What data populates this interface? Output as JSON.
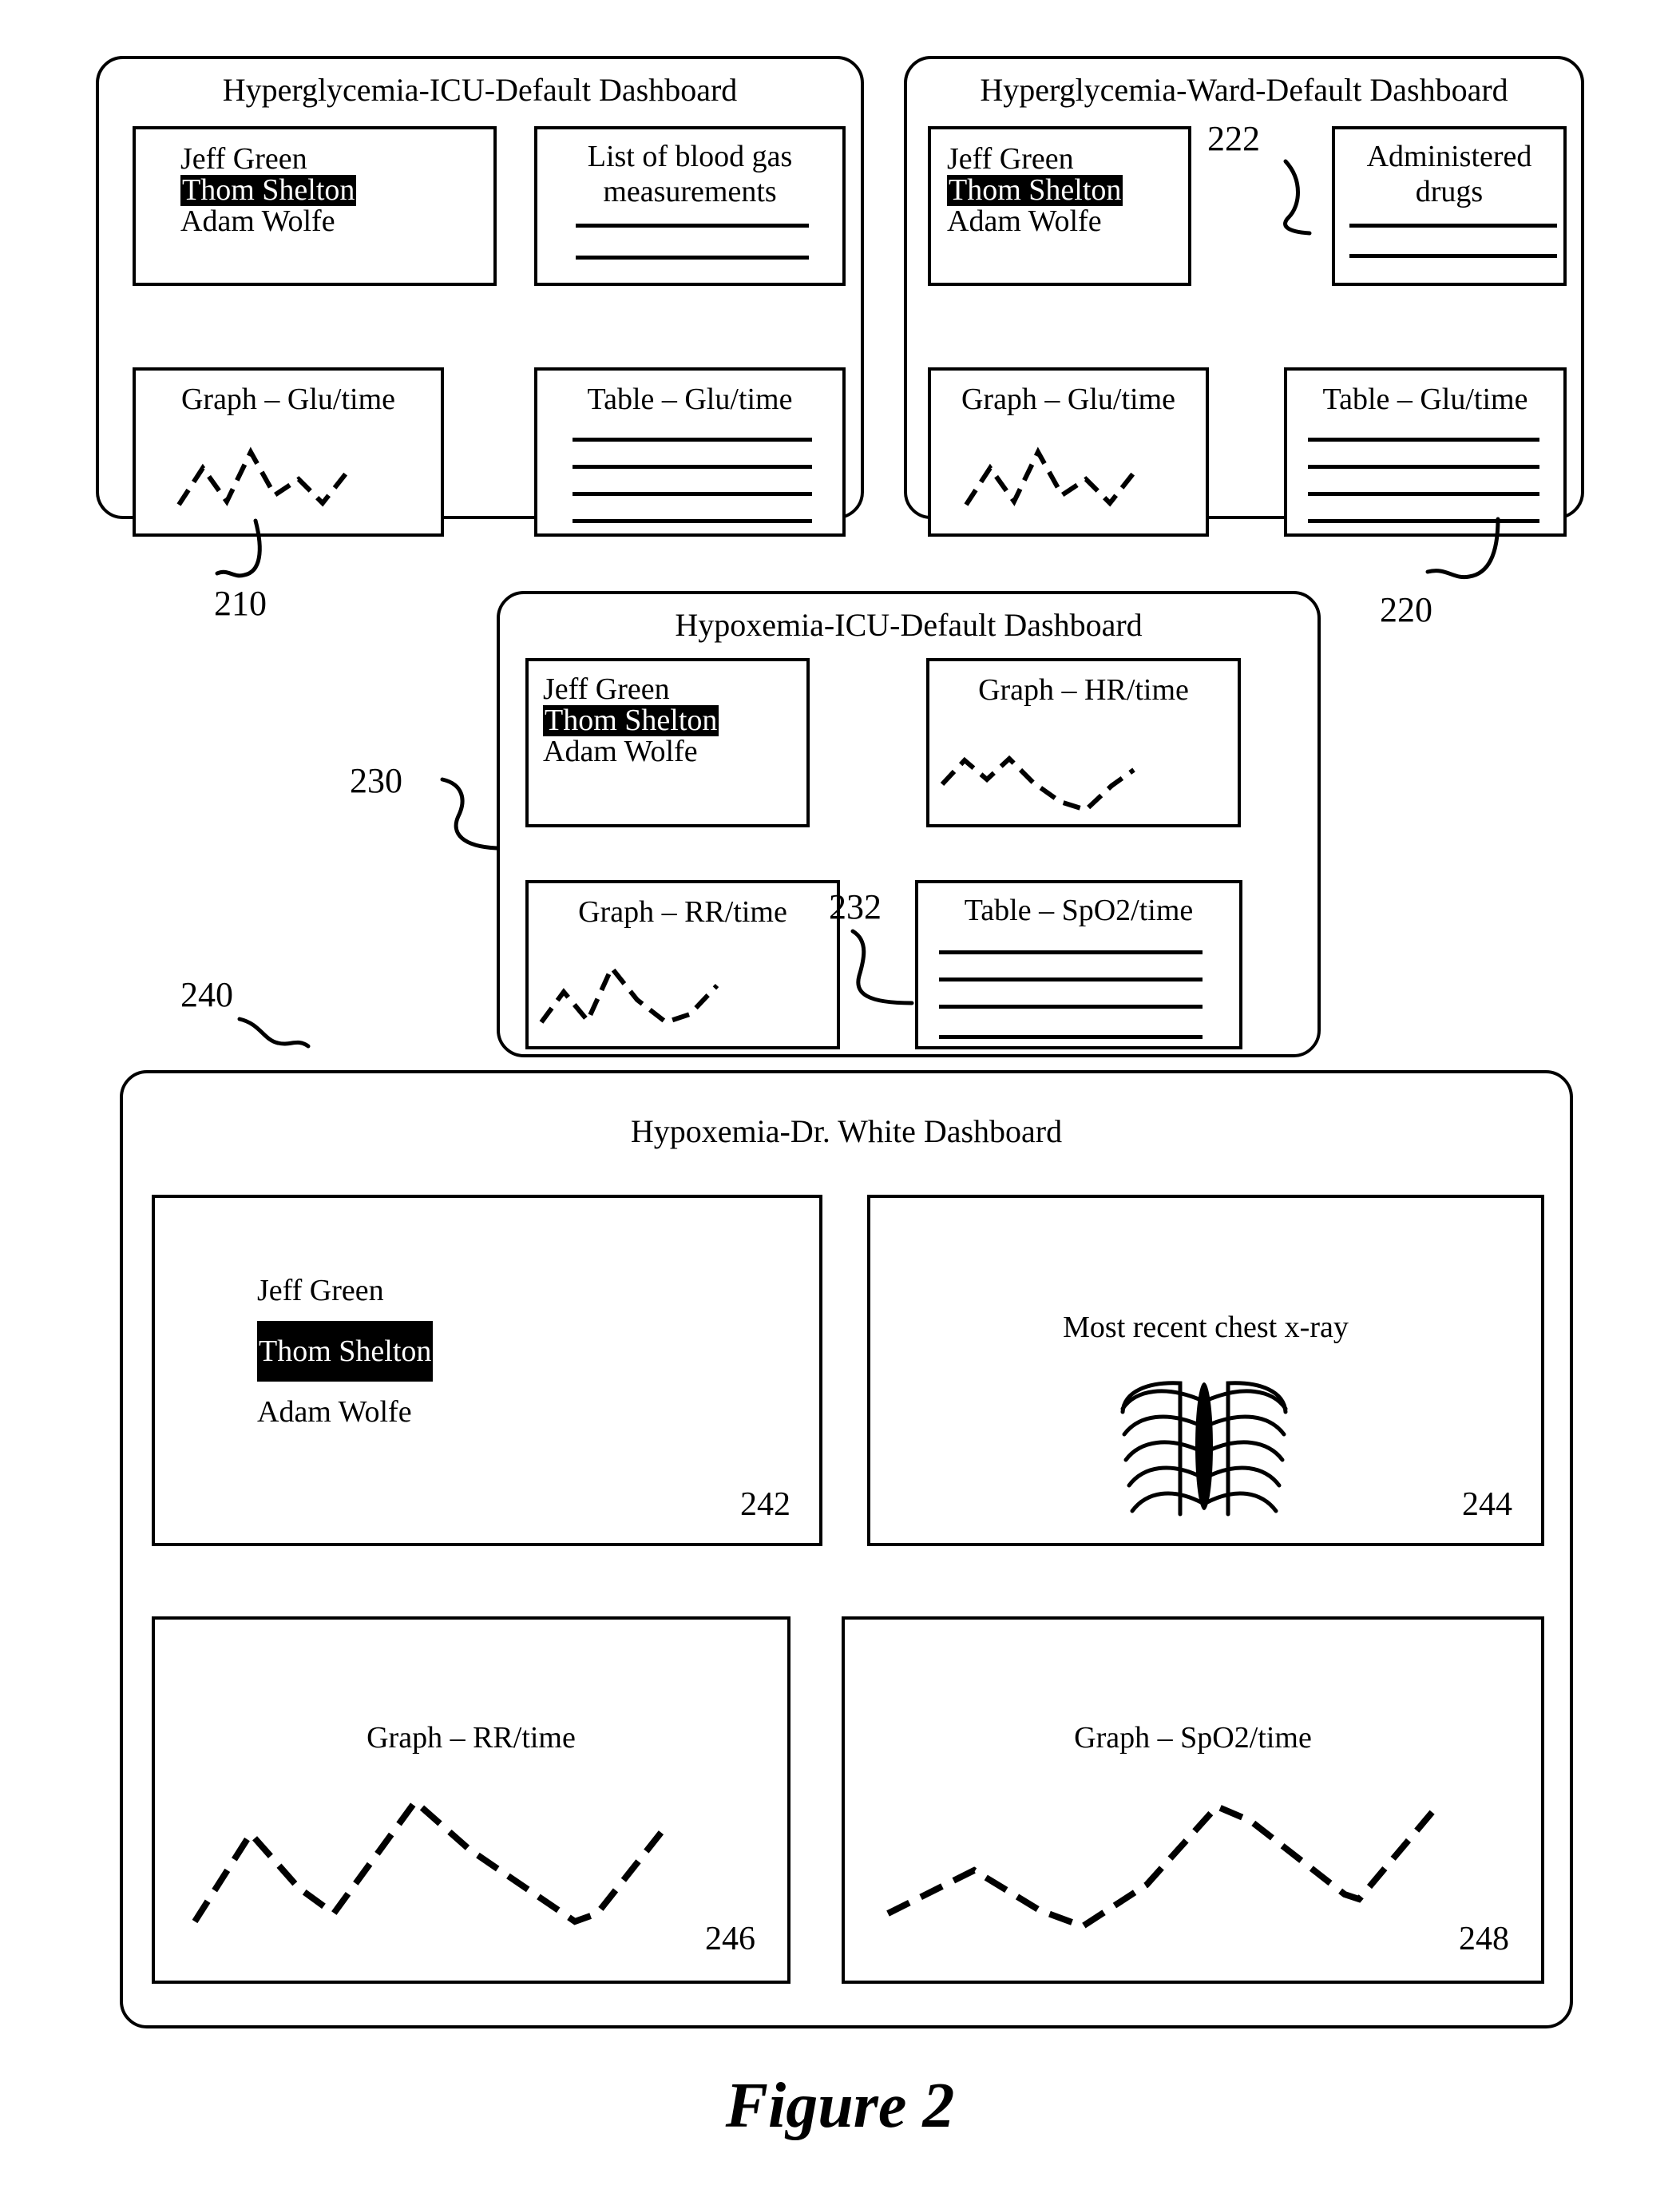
{
  "figure": {
    "caption": "Figure 2"
  },
  "patients": {
    "list": [
      "Jeff Green",
      "Thom Shelton",
      "Adam Wolfe"
    ],
    "selected": "Thom Shelton",
    "selected_index": 1
  },
  "dashboards": [
    {
      "id": "hyperglycemia-icu-default",
      "title": "Hyperglycemia-ICU-Default Dashboard",
      "ref": "210",
      "panels": [
        {
          "id": "patient-list",
          "title": "",
          "kind": "name-list"
        },
        {
          "id": "blood-gas-list",
          "title": "List of blood gas measurements",
          "kind": "list",
          "rule_count": 2
        },
        {
          "id": "graph-glu-time",
          "title": "Graph – Glu/time",
          "kind": "graph"
        },
        {
          "id": "table-glu-time",
          "title": "Table – Glu/time",
          "kind": "table",
          "rule_count": 4
        }
      ]
    },
    {
      "id": "hyperglycemia-ward-default",
      "title": "Hyperglycemia-Ward-Default Dashboard",
      "ref": "220",
      "panels": [
        {
          "id": "patient-list",
          "title": "",
          "kind": "name-list"
        },
        {
          "id": "administered-drugs",
          "title": "Administered drugs",
          "kind": "list",
          "ref": "222",
          "rule_count": 2
        },
        {
          "id": "graph-glu-time",
          "title": "Graph – Glu/time",
          "kind": "graph"
        },
        {
          "id": "table-glu-time",
          "title": "Table – Glu/time",
          "kind": "table",
          "rule_count": 4
        }
      ]
    },
    {
      "id": "hypoxemia-icu-default",
      "title": "Hypoxemia-ICU-Default Dashboard",
      "ref": "230",
      "panels": [
        {
          "id": "patient-list",
          "title": "",
          "kind": "name-list"
        },
        {
          "id": "graph-hr-time",
          "title": "Graph – HR/time",
          "kind": "graph"
        },
        {
          "id": "graph-rr-time",
          "title": "Graph – RR/time",
          "kind": "graph"
        },
        {
          "id": "table-spo2-time",
          "title": "Table – SpO2/time",
          "kind": "table",
          "ref": "232",
          "rule_count": 4
        }
      ]
    },
    {
      "id": "hypoxemia-dr-white",
      "title": "Hypoxemia-Dr. White Dashboard",
      "ref": "240",
      "panels": [
        {
          "id": "patient-list",
          "title": "",
          "kind": "name-list",
          "ref": "242"
        },
        {
          "id": "chest-xray",
          "title": "Most recent chest x-ray",
          "kind": "image",
          "ref": "244"
        },
        {
          "id": "graph-rr-time",
          "title": "Graph – RR/time",
          "kind": "graph",
          "ref": "246"
        },
        {
          "id": "graph-spo2-time",
          "title": "Graph – SpO2/time",
          "kind": "graph",
          "ref": "248"
        }
      ]
    }
  ],
  "labels": {
    "title_210": "Hyperglycemia-ICU-Default Dashboard",
    "title_220": "Hyperglycemia-Ward-Default Dashboard",
    "title_230": "Hypoxemia-ICU-Default Dashboard",
    "title_240": "Hypoxemia-Dr. White Dashboard",
    "blood_gas_line1": "List of blood gas",
    "blood_gas_line2": "measurements",
    "admin_drugs_line1": "Administered",
    "admin_drugs_line2": "drugs",
    "graph_glu": "Graph – Glu/time",
    "table_glu": "Table – Glu/time",
    "graph_hr": "Graph – HR/time",
    "graph_rr": "Graph – RR/time",
    "table_spo2": "Table – SpO2/time",
    "graph_spo2": "Graph – SpO2/time",
    "chest_xray": "Most recent chest x-ray",
    "name_1": "Jeff Green",
    "name_2": "Thom Shelton",
    "name_3": "Adam Wolfe",
    "ref_210": "210",
    "ref_220": "220",
    "ref_222": "222",
    "ref_230": "230",
    "ref_232": "232",
    "ref_240": "240",
    "ref_242": "242",
    "ref_244": "244",
    "ref_246": "246",
    "ref_248": "248",
    "caption": "Figure 2"
  },
  "colors": {
    "ink": "#000000",
    "paper": "#ffffff",
    "highlight_bg": "#000000",
    "highlight_fg": "#ffffff"
  }
}
